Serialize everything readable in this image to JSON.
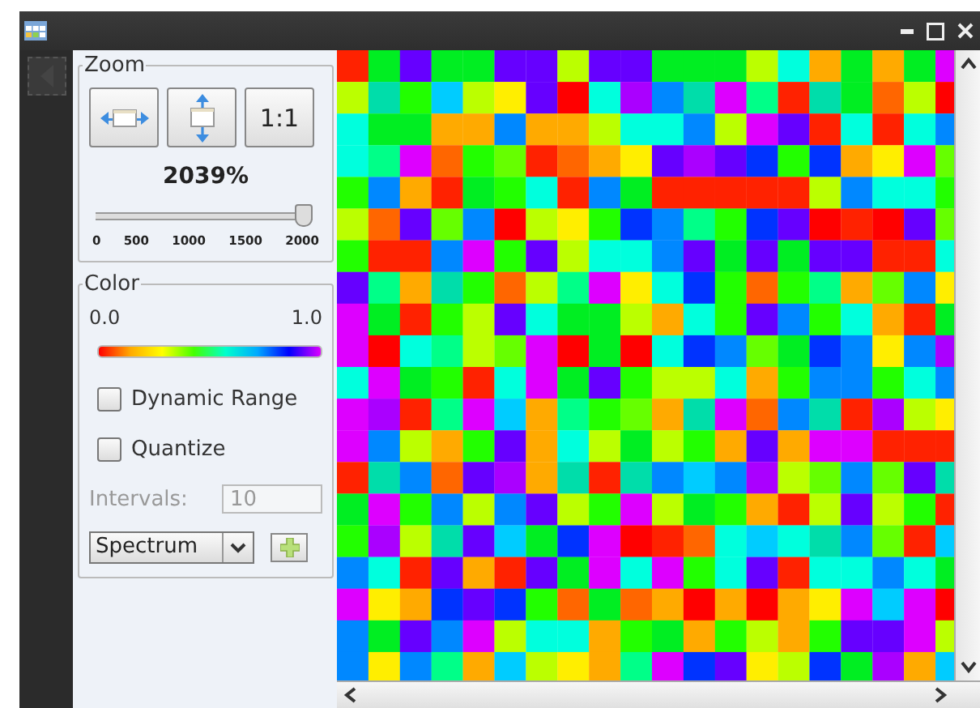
{
  "zoom": {
    "title": "Zoom",
    "buttons": [
      {
        "kind": "fit-width"
      },
      {
        "kind": "fit-height"
      },
      {
        "kind": "text",
        "label": "1:1"
      }
    ],
    "value": "2039%",
    "slider": {
      "level": 1.0,
      "ticks": [
        "0",
        "500",
        "1000",
        "1500",
        "2000"
      ]
    }
  },
  "color": {
    "title": "Color",
    "min": "0.0",
    "max": "1.0",
    "options": [
      {
        "label": "Dynamic Range",
        "checked": false
      },
      {
        "label": "Quantize",
        "checked": false
      }
    ],
    "intervals": {
      "label": "Intervals:",
      "value": "10",
      "disabled": true
    },
    "colormap": "Spectrum"
  }
}
